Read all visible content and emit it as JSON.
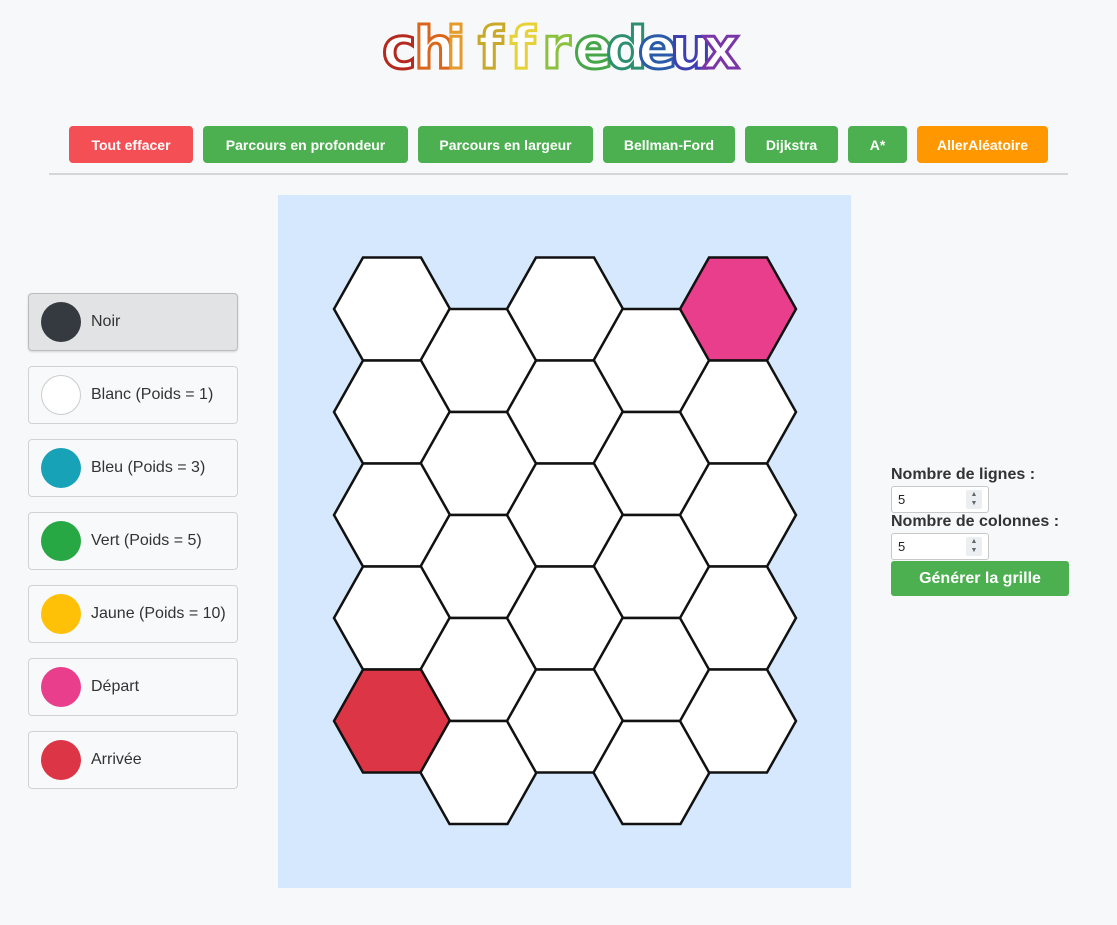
{
  "logo": {
    "text": "chiffredeux",
    "letter_colors": [
      "#b42a1f",
      "#d9661b",
      "#e59b2a",
      "#c8a929",
      "#e6d238",
      "#8bc13c",
      "#47a64a",
      "#2d8e72",
      "#2b5aa8",
      "#3f3fb0",
      "#7a36a8"
    ]
  },
  "toolbar": {
    "clear_label": "Tout effacer",
    "dfs_label": "Parcours en profondeur",
    "bfs_label": "Parcours en largeur",
    "bellman_label": "Bellman-Ford",
    "dijkstra_label": "Dijkstra",
    "astar_label": "A*",
    "random_label": "AllerAléatoire"
  },
  "colors": {
    "green": "#4caf50",
    "red_button": "#f44f55",
    "orange": "#ff9800",
    "board_bg": "#d6e8fd",
    "start": "#e83e8c",
    "end": "#dc3545"
  },
  "palette": {
    "selected": "Noir",
    "items": [
      {
        "label": "Noir",
        "color": "#343a40"
      },
      {
        "label": "Blanc (Poids = 1)",
        "color": "#ffffff"
      },
      {
        "label": "Bleu (Poids = 3)",
        "color": "#17a2b8"
      },
      {
        "label": "Vert (Poids = 5)",
        "color": "#28a745"
      },
      {
        "label": "Jaune (Poids = 10)",
        "color": "#ffc107"
      },
      {
        "label": "Départ",
        "color": "#e83e8c"
      },
      {
        "label": "Arrivée",
        "color": "#dc3545"
      }
    ]
  },
  "grid": {
    "rows": 5,
    "cols": 5,
    "cells": [
      [
        "white",
        "white",
        "white",
        "white",
        "start"
      ],
      [
        "white",
        "white",
        "white",
        "white",
        "white"
      ],
      [
        "white",
        "white",
        "white",
        "white",
        "white"
      ],
      [
        "white",
        "white",
        "white",
        "white",
        "white"
      ],
      [
        "end",
        "white",
        "white",
        "white",
        "white"
      ]
    ]
  },
  "controls": {
    "rows_label": "Nombre de lignes :",
    "rows_value": "5",
    "cols_label": "Nombre de colonnes :",
    "cols_value": "5",
    "generate_label": "Générer la grille"
  }
}
